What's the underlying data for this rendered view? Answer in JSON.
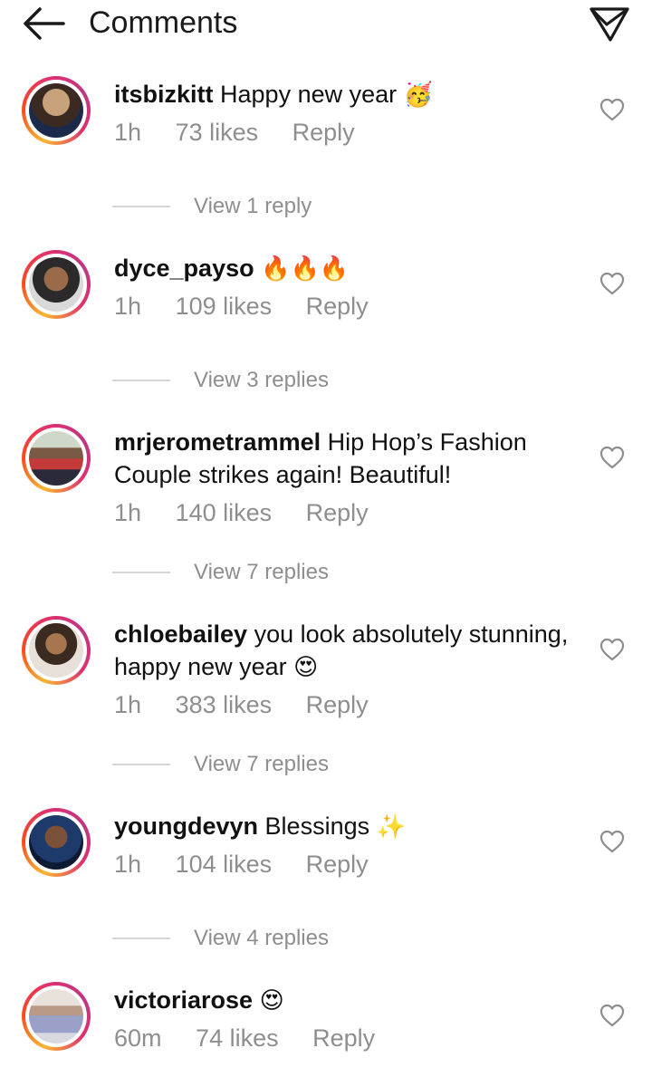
{
  "header": {
    "title": "Comments"
  },
  "comments": [
    {
      "username": "itsbizkitt",
      "text": "Happy new year",
      "emoji": "🥳",
      "time": "1h",
      "likes": "73 likes",
      "reply": "Reply",
      "view_replies": "View 1 reply"
    },
    {
      "username": "dyce_payso",
      "text": "",
      "emoji": "🔥🔥🔥",
      "time": "1h",
      "likes": "109 likes",
      "reply": "Reply",
      "view_replies": "View 3 replies"
    },
    {
      "username": "mrjerometrammel",
      "text": "Hip Hop’s Fashion Couple strikes again! Beautiful!",
      "emoji": "",
      "time": "1h",
      "likes": "140 likes",
      "reply": "Reply",
      "view_replies": "View 7 replies"
    },
    {
      "username": "chloebailey",
      "text": "you look absolutely stunning, happy new year",
      "emoji": "😍",
      "time": "1h",
      "likes": "383 likes",
      "reply": "Reply",
      "view_replies": "View 7 replies"
    },
    {
      "username": "youngdevyn",
      "text": "Blessings",
      "emoji": "✨",
      "time": "1h",
      "likes": "104 likes",
      "reply": "Reply",
      "view_replies": "View 4 replies"
    },
    {
      "username": "victoriarose",
      "text": "",
      "emoji": "😍",
      "time": "60m",
      "likes": "74 likes",
      "reply": "Reply"
    }
  ],
  "colors": {
    "meta_gray": "#8e8e8e",
    "ring_start": "#f7b733",
    "ring_mid": "#e1306c",
    "ring_end": "#c13584"
  },
  "icons": {
    "back": "arrow-left-icon",
    "send": "paper-plane-icon",
    "like": "heart-outline-icon"
  }
}
